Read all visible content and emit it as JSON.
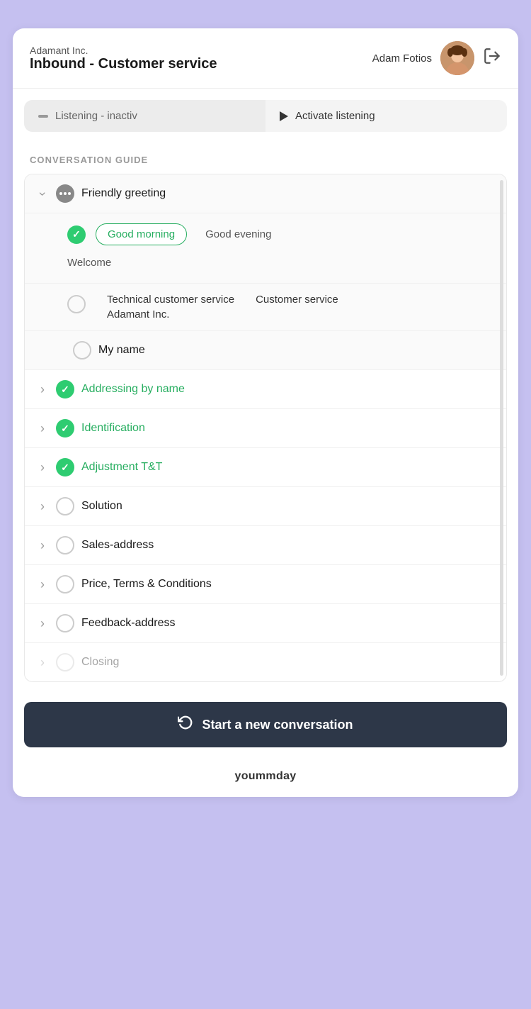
{
  "header": {
    "company": "Adamant Inc.",
    "queue": "Inbound - Customer service",
    "agent": "Adam Fotios",
    "logout_icon": "→"
  },
  "status": {
    "inactive_label": "Listening - inactiv",
    "activate_label": "Activate listening"
  },
  "guide": {
    "title": "CONVERSATION GUIDE",
    "items": [
      {
        "id": "friendly-greeting",
        "chevron": "down",
        "check": "dots",
        "label": "Friendly greeting",
        "expanded": true
      },
      {
        "id": "addressing-by-name",
        "chevron": "right",
        "check": "checked",
        "label": "Addressing by name"
      },
      {
        "id": "identification",
        "chevron": "right",
        "check": "checked",
        "label": "Identification"
      },
      {
        "id": "adjustment",
        "chevron": "right",
        "check": "checked",
        "label": "Adjustment T&T"
      },
      {
        "id": "solution",
        "chevron": "right",
        "check": "empty",
        "label": "Solution"
      },
      {
        "id": "sales-address",
        "chevron": "right",
        "check": "empty",
        "label": "Sales-address"
      },
      {
        "id": "price-terms",
        "chevron": "right",
        "check": "empty",
        "label": "Price, Terms & Conditions"
      },
      {
        "id": "feedback-address",
        "chevron": "right",
        "check": "empty",
        "label": "Feedback-address"
      },
      {
        "id": "closing",
        "chevron": "right",
        "check": "empty",
        "label": "Closing"
      }
    ],
    "greeting_options": {
      "option1": "Good morning",
      "option2": "Good evening",
      "option3": "Welcome"
    },
    "service_options": {
      "opt1": "Technical customer service",
      "opt2": "Customer service",
      "opt3": "Adamant Inc."
    },
    "my_name_label": "My name"
  },
  "start_btn": {
    "label": "Start a new conversation"
  },
  "footer": {
    "brand": "yoummday"
  }
}
